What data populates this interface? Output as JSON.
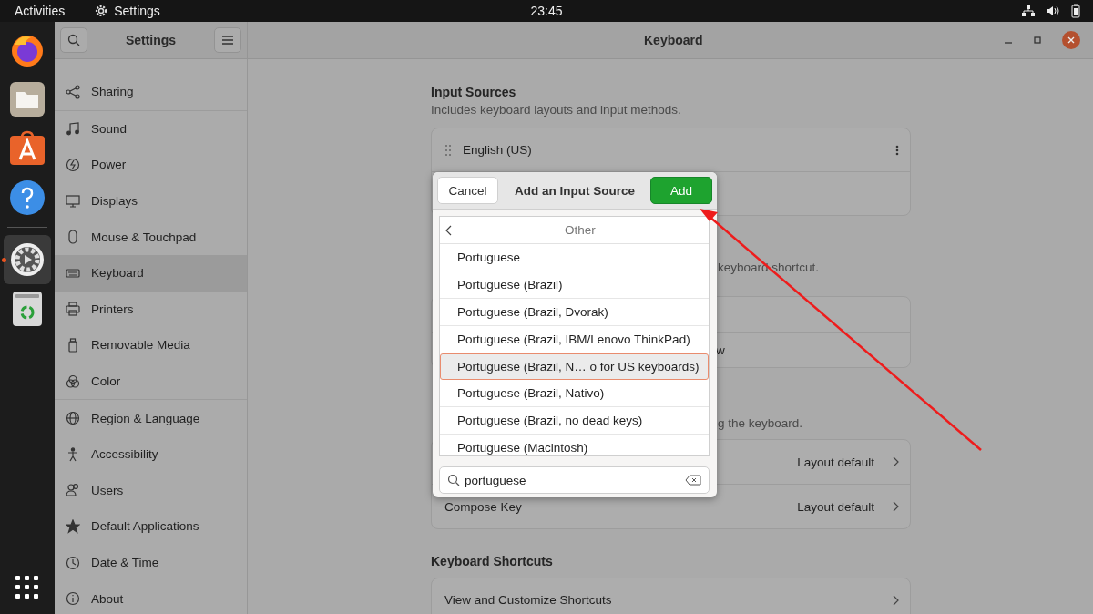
{
  "top_bar": {
    "activities": "Activities",
    "app_name": "Settings",
    "clock": "23:45"
  },
  "dock": {
    "items": [
      {
        "kind": "browser",
        "active": false
      },
      {
        "kind": "files",
        "active": false
      },
      {
        "kind": "store",
        "active": false
      },
      {
        "kind": "help",
        "active": false
      },
      {
        "kind": "settings",
        "active": true
      },
      {
        "kind": "trash",
        "active": false
      }
    ]
  },
  "window": {
    "sidebar_title": "Settings",
    "title": "Keyboard"
  },
  "sidebar": {
    "groups": [
      [
        {
          "label": "Sharing",
          "selected": false
        }
      ],
      [
        {
          "label": "Sound",
          "selected": false
        },
        {
          "label": "Power",
          "selected": false
        },
        {
          "label": "Displays",
          "selected": false
        },
        {
          "label": "Mouse & Touchpad",
          "selected": false
        },
        {
          "label": "Keyboard",
          "selected": true
        },
        {
          "label": "Printers",
          "selected": false
        },
        {
          "label": "Removable Media",
          "selected": false
        },
        {
          "label": "Color",
          "selected": false
        }
      ],
      [
        {
          "label": "Region & Language",
          "selected": false
        },
        {
          "label": "Accessibility",
          "selected": false
        },
        {
          "label": "Users",
          "selected": false
        },
        {
          "label": "Default Applications",
          "selected": false
        },
        {
          "label": "Date & Time",
          "selected": false
        },
        {
          "label": "About",
          "selected": false
        }
      ]
    ]
  },
  "input_sources": {
    "title": "Input Sources",
    "subtitle": "Includes keyboard layouts and input methods.",
    "rows": [
      {
        "label": "English (US)"
      }
    ]
  },
  "switching": {
    "subtitle": "keyboard shortcut.",
    "row_text": "w"
  },
  "special_keys": {
    "subtitle": "g the keyboard.",
    "rows": [
      {
        "value": "Layout default"
      },
      {
        "label": "Compose Key",
        "value": "Layout default"
      }
    ]
  },
  "shortcuts": {
    "title": "Keyboard Shortcuts",
    "rows": [
      {
        "label": "View and Customize Shortcuts"
      }
    ]
  },
  "dialog": {
    "cancel": "Cancel",
    "title": "Add an Input Source",
    "add": "Add",
    "list_header": "Other",
    "items": [
      {
        "label": "Portuguese",
        "selected": false
      },
      {
        "label": "Portuguese (Brazil)",
        "selected": false
      },
      {
        "label": "Portuguese (Brazil, Dvorak)",
        "selected": false
      },
      {
        "label": "Portuguese (Brazil, IBM/Lenovo ThinkPad)",
        "selected": false
      },
      {
        "label": "Portuguese (Brazil, N… o for US keyboards)",
        "selected": true
      },
      {
        "label": "Portuguese (Brazil, Nativo)",
        "selected": false
      },
      {
        "label": "Portuguese (Brazil, no dead keys)",
        "selected": false
      },
      {
        "label": "Portuguese (Macintosh)",
        "selected": false
      }
    ],
    "search": {
      "value": "portuguese"
    }
  }
}
